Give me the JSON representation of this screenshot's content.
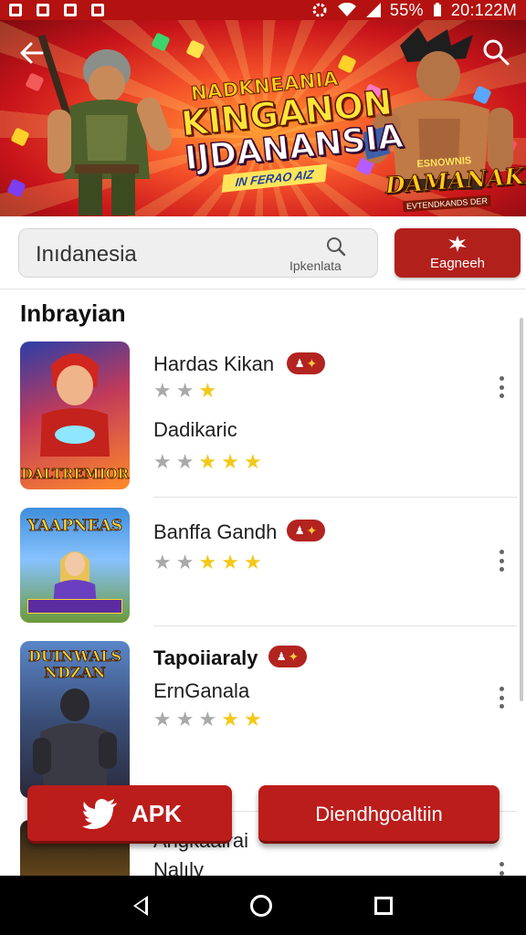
{
  "status_bar": {
    "battery": "55%",
    "time": "20:122M",
    "icons": [
      "notification-icon",
      "image-icon",
      "calendar-icon",
      "sim-icon",
      "settings-icon",
      "wifi-icon",
      "signal-icon",
      "battery-icon"
    ]
  },
  "banner": {
    "line1": "NADKNEANIA",
    "line2": "KINGANON",
    "line3": "IJDANANSIA",
    "ribbon": "IN FERAO AIZ",
    "logo_top": "ESNOWNIS",
    "logo_main": "DAMANAKIA",
    "logo_sub": "EVTENDKANDS DER",
    "back_icon": "arrow-left-icon",
    "search_icon": "search-icon"
  },
  "search": {
    "value": "Inıdanesia",
    "hint": "Ipkenlata"
  },
  "action_button": {
    "label": "Eagneeh",
    "icon": "star-burst-icon"
  },
  "section": {
    "title": "Inbrayian"
  },
  "apps": [
    {
      "name": "Hardas Kikan",
      "rating_a": 1,
      "rating_a_scale": 3,
      "subtitle": "Dadikaric",
      "rating": 3,
      "thumb_caption": "DALTREMIOR"
    },
    {
      "name": "Banffa Gandh",
      "rating": 3,
      "thumb_caption": "YAAPNEAS"
    },
    {
      "name": "Tapoiiaraly",
      "subtitle": "ErnGanala",
      "rating": 2,
      "thumb_caption": "DUINWALS NDZAN"
    },
    {
      "name": "Angkaairai",
      "subtitle": "Nalıly",
      "thumb_caption": ""
    }
  ],
  "bottom_buttons": {
    "apk": "APK",
    "download": "Diendhgoaltiin"
  },
  "colors": {
    "brand_red": "#b2201c",
    "star_yellow": "#f2c91a",
    "star_gray": "#a9a9a9"
  }
}
